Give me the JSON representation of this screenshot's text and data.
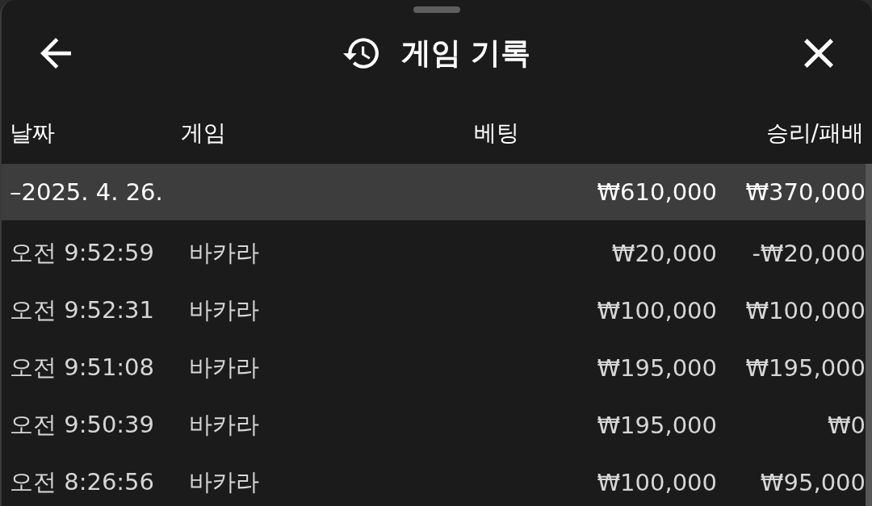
{
  "sheet": {
    "title": "게임 기록"
  },
  "table": {
    "columns": [
      "날짜",
      "게임",
      "베팅",
      "승리/패배"
    ],
    "groups": [
      {
        "label": "–2025. 4. 26.",
        "bet_total": "₩610,000",
        "result_total": "₩370,000",
        "rows": [
          {
            "time": "오전 9:52:59",
            "game": "바카라",
            "bet": "₩20,000",
            "result": "-₩20,000"
          },
          {
            "time": "오전 9:52:31",
            "game": "바카라",
            "bet": "₩100,000",
            "result": "₩100,000"
          },
          {
            "time": "오전 9:51:08",
            "game": "바카라",
            "bet": "₩195,000",
            "result": "₩195,000"
          },
          {
            "time": "오전 9:50:39",
            "game": "바카라",
            "bet": "₩195,000",
            "result": "₩0"
          },
          {
            "time": "오전 8:26:56",
            "game": "바카라",
            "bet": "₩100,000",
            "result": "₩95,000"
          }
        ]
      }
    ]
  }
}
